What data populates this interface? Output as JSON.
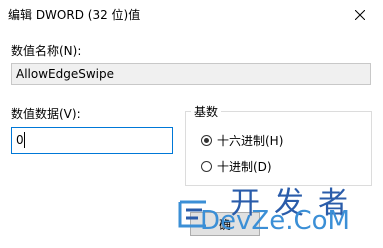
{
  "dialog": {
    "title": "编辑 DWORD (32 位)值",
    "close_icon": "close-icon"
  },
  "value_name": {
    "label": "数值名称(N):",
    "value": "AllowEdgeSwipe"
  },
  "value_data": {
    "label": "数值数据(V):",
    "value": "0"
  },
  "base": {
    "title": "基数",
    "options": [
      {
        "label": "十六进制(H)",
        "checked": true
      },
      {
        "label": "十进制(D)",
        "checked": false
      }
    ]
  },
  "button_partial": "确",
  "watermark": {
    "top": "开发者",
    "bottom": "DevZe.CoM"
  },
  "colors": {
    "focus_border": "#0078d7",
    "watermark_dark": "#2a5caa",
    "watermark_light": "#3b8fd6"
  }
}
